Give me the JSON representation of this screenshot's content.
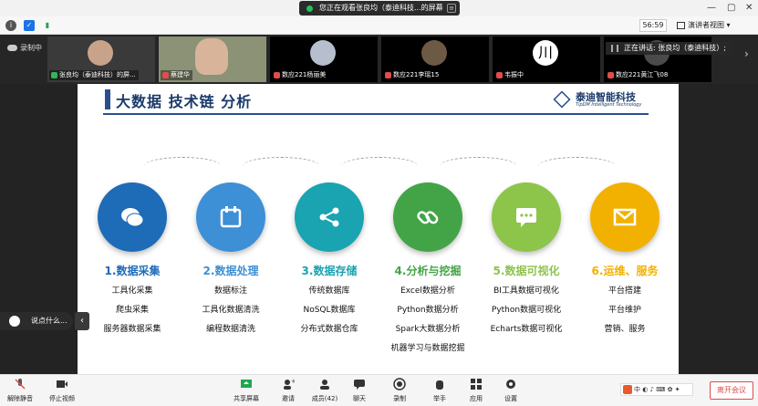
{
  "window": {
    "share_notice": "您正在观看张良均（泰迪科技...的屏幕",
    "controls": [
      "—",
      "▢",
      "✕"
    ]
  },
  "meeting_bar": {
    "timer": "56:59",
    "view_label": "演讲者视图"
  },
  "participants": {
    "recording_label": "录制中",
    "speaking_label": "正在讲话: 张良均（泰迪科技）;",
    "tiles": [
      {
        "name": "张良均（泰迪科技）的屏..."
      },
      {
        "name": "蔡建华"
      },
      {
        "name": "数应221杨丽美"
      },
      {
        "name": "数应221李瑶15"
      },
      {
        "name": "韦振中"
      },
      {
        "name": "数应221黄江飞08"
      }
    ]
  },
  "slide": {
    "title": "大数据 技术链 分析",
    "logo_cn": "泰迪智能科技",
    "logo_en": "TipDM Intelligent Technology",
    "stages": [
      {
        "title": "1.数据采集",
        "color": "#1e6bb8",
        "title_color": "#1e6bb8",
        "icon": "chat-bubbles-icon",
        "items": [
          "工具化采集",
          "爬虫采集",
          "服务器数据采集"
        ]
      },
      {
        "title": "2.数据处理",
        "color": "#3d8fd6",
        "title_color": "#3d8fd6",
        "icon": "calendar-icon",
        "items": [
          "数据标注",
          "工具化数据清洗",
          "编程数据清洗"
        ]
      },
      {
        "title": "3.数据存储",
        "color": "#1aa3b0",
        "title_color": "#1aa3b0",
        "icon": "share-icon",
        "items": [
          "传统数据库",
          "NoSQL数据库",
          "分布式数据仓库"
        ]
      },
      {
        "title": "4.分析与挖掘",
        "color": "#43a447",
        "title_color": "#43a447",
        "icon": "link-icon",
        "items": [
          "Excel数据分析",
          "Python数据分析",
          "Spark大数据分析",
          "机器学习与数据挖掘"
        ]
      },
      {
        "title": "5.数据可视化",
        "color": "#8dc44a",
        "title_color": "#8dc44a",
        "icon": "message-dots-icon",
        "items": [
          "BI工具数据可视化",
          "Python数据可视化",
          "Echarts数据可视化"
        ]
      },
      {
        "title": "6.运维、服务",
        "color": "#f2b100",
        "title_color": "#f2b100",
        "icon": "envelope-icon",
        "items": [
          "平台搭建",
          "平台维护",
          "营销、服务"
        ]
      }
    ]
  },
  "chat": {
    "placeholder": "说点什么..."
  },
  "toolbar": {
    "mute": "解除静音",
    "video": "停止视频",
    "share": "共享屏幕",
    "invite": "邀请",
    "members": "成员(42)",
    "chat": "聊天",
    "record": "录制",
    "raise_hand": "举手",
    "apps": "应用",
    "settings": "设置",
    "leave": "离开会议",
    "ime": "中 ◐ ♪ ⌨ ✿ ✦"
  }
}
